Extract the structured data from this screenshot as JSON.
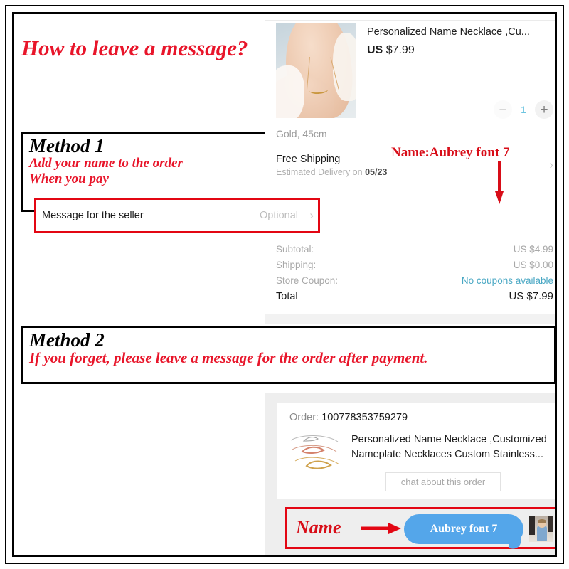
{
  "headline": "How to leave a message?",
  "method1": {
    "title": "Method 1",
    "line1": "Add your name to the order",
    "line2": "When you pay"
  },
  "method2": {
    "title": "Method 2",
    "line1": "If you forget, please leave a message for the order after payment."
  },
  "checkout": {
    "product_title": "Personalized Name Necklace ,Cu...",
    "price_currency": "US",
    "price_amount": "$7.99",
    "variant": "Gold, 45cm",
    "qty_minus": "−",
    "qty_value": "1",
    "qty_plus": "+",
    "shipping_title": "Free Shipping",
    "shipping_estimate_prefix": "Estimated Delivery on ",
    "shipping_estimate_date": "05/23",
    "chevron": "›",
    "message_label": "Message for the seller",
    "message_placeholder": "Optional",
    "summary": [
      {
        "label": "Subtotal:",
        "value": "US $4.99",
        "accent": false
      },
      {
        "label": "Shipping:",
        "value": "US $0.00",
        "accent": false
      },
      {
        "label": "Store Coupon:",
        "value": "No coupons available",
        "accent": true
      },
      {
        "label": "Total",
        "value": "US $7.99",
        "accent": false
      }
    ]
  },
  "annotation_top": "Name:Aubrey    font 7",
  "order": {
    "order_label": "Order: ",
    "order_number": "100778353759279",
    "description": "Personalized Name Necklace ,Customized Nameplate Necklaces Custom Stainless...",
    "chat_button": "chat about this order",
    "name_label": "Name",
    "chat_bubble_text": "Aubrey    font 7"
  },
  "colors": {
    "annotation_red": "#d80d18",
    "box_red": "#e30613",
    "headline_red": "#e8152a",
    "chat_blue": "#54a6ea",
    "coupon_teal": "#4aa8c4",
    "qty_blue": "#6cc4e0"
  }
}
